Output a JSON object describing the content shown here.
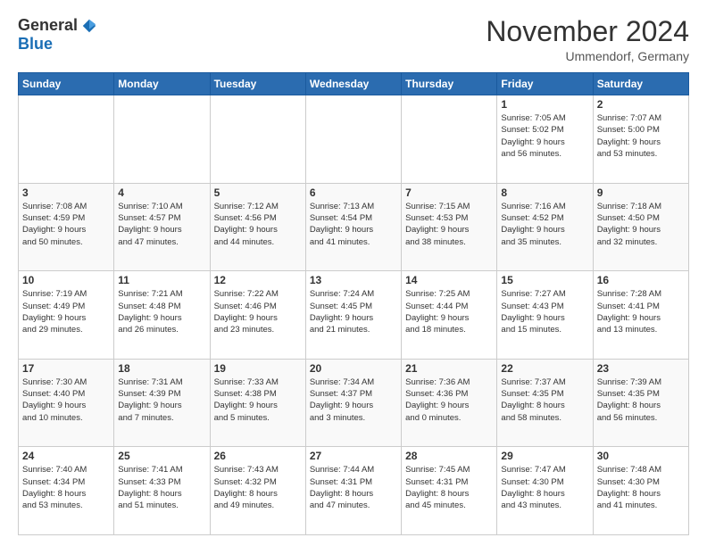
{
  "header": {
    "logo_general": "General",
    "logo_blue": "Blue",
    "month_title": "November 2024",
    "location": "Ummendorf, Germany"
  },
  "weekdays": [
    "Sunday",
    "Monday",
    "Tuesday",
    "Wednesday",
    "Thursday",
    "Friday",
    "Saturday"
  ],
  "weeks": [
    [
      {
        "day": "",
        "info": ""
      },
      {
        "day": "",
        "info": ""
      },
      {
        "day": "",
        "info": ""
      },
      {
        "day": "",
        "info": ""
      },
      {
        "day": "",
        "info": ""
      },
      {
        "day": "1",
        "info": "Sunrise: 7:05 AM\nSunset: 5:02 PM\nDaylight: 9 hours\nand 56 minutes."
      },
      {
        "day": "2",
        "info": "Sunrise: 7:07 AM\nSunset: 5:00 PM\nDaylight: 9 hours\nand 53 minutes."
      }
    ],
    [
      {
        "day": "3",
        "info": "Sunrise: 7:08 AM\nSunset: 4:59 PM\nDaylight: 9 hours\nand 50 minutes."
      },
      {
        "day": "4",
        "info": "Sunrise: 7:10 AM\nSunset: 4:57 PM\nDaylight: 9 hours\nand 47 minutes."
      },
      {
        "day": "5",
        "info": "Sunrise: 7:12 AM\nSunset: 4:56 PM\nDaylight: 9 hours\nand 44 minutes."
      },
      {
        "day": "6",
        "info": "Sunrise: 7:13 AM\nSunset: 4:54 PM\nDaylight: 9 hours\nand 41 minutes."
      },
      {
        "day": "7",
        "info": "Sunrise: 7:15 AM\nSunset: 4:53 PM\nDaylight: 9 hours\nand 38 minutes."
      },
      {
        "day": "8",
        "info": "Sunrise: 7:16 AM\nSunset: 4:52 PM\nDaylight: 9 hours\nand 35 minutes."
      },
      {
        "day": "9",
        "info": "Sunrise: 7:18 AM\nSunset: 4:50 PM\nDaylight: 9 hours\nand 32 minutes."
      }
    ],
    [
      {
        "day": "10",
        "info": "Sunrise: 7:19 AM\nSunset: 4:49 PM\nDaylight: 9 hours\nand 29 minutes."
      },
      {
        "day": "11",
        "info": "Sunrise: 7:21 AM\nSunset: 4:48 PM\nDaylight: 9 hours\nand 26 minutes."
      },
      {
        "day": "12",
        "info": "Sunrise: 7:22 AM\nSunset: 4:46 PM\nDaylight: 9 hours\nand 23 minutes."
      },
      {
        "day": "13",
        "info": "Sunrise: 7:24 AM\nSunset: 4:45 PM\nDaylight: 9 hours\nand 21 minutes."
      },
      {
        "day": "14",
        "info": "Sunrise: 7:25 AM\nSunset: 4:44 PM\nDaylight: 9 hours\nand 18 minutes."
      },
      {
        "day": "15",
        "info": "Sunrise: 7:27 AM\nSunset: 4:43 PM\nDaylight: 9 hours\nand 15 minutes."
      },
      {
        "day": "16",
        "info": "Sunrise: 7:28 AM\nSunset: 4:41 PM\nDaylight: 9 hours\nand 13 minutes."
      }
    ],
    [
      {
        "day": "17",
        "info": "Sunrise: 7:30 AM\nSunset: 4:40 PM\nDaylight: 9 hours\nand 10 minutes."
      },
      {
        "day": "18",
        "info": "Sunrise: 7:31 AM\nSunset: 4:39 PM\nDaylight: 9 hours\nand 7 minutes."
      },
      {
        "day": "19",
        "info": "Sunrise: 7:33 AM\nSunset: 4:38 PM\nDaylight: 9 hours\nand 5 minutes."
      },
      {
        "day": "20",
        "info": "Sunrise: 7:34 AM\nSunset: 4:37 PM\nDaylight: 9 hours\nand 3 minutes."
      },
      {
        "day": "21",
        "info": "Sunrise: 7:36 AM\nSunset: 4:36 PM\nDaylight: 9 hours\nand 0 minutes."
      },
      {
        "day": "22",
        "info": "Sunrise: 7:37 AM\nSunset: 4:35 PM\nDaylight: 8 hours\nand 58 minutes."
      },
      {
        "day": "23",
        "info": "Sunrise: 7:39 AM\nSunset: 4:35 PM\nDaylight: 8 hours\nand 56 minutes."
      }
    ],
    [
      {
        "day": "24",
        "info": "Sunrise: 7:40 AM\nSunset: 4:34 PM\nDaylight: 8 hours\nand 53 minutes."
      },
      {
        "day": "25",
        "info": "Sunrise: 7:41 AM\nSunset: 4:33 PM\nDaylight: 8 hours\nand 51 minutes."
      },
      {
        "day": "26",
        "info": "Sunrise: 7:43 AM\nSunset: 4:32 PM\nDaylight: 8 hours\nand 49 minutes."
      },
      {
        "day": "27",
        "info": "Sunrise: 7:44 AM\nSunset: 4:31 PM\nDaylight: 8 hours\nand 47 minutes."
      },
      {
        "day": "28",
        "info": "Sunrise: 7:45 AM\nSunset: 4:31 PM\nDaylight: 8 hours\nand 45 minutes."
      },
      {
        "day": "29",
        "info": "Sunrise: 7:47 AM\nSunset: 4:30 PM\nDaylight: 8 hours\nand 43 minutes."
      },
      {
        "day": "30",
        "info": "Sunrise: 7:48 AM\nSunset: 4:30 PM\nDaylight: 8 hours\nand 41 minutes."
      }
    ]
  ]
}
